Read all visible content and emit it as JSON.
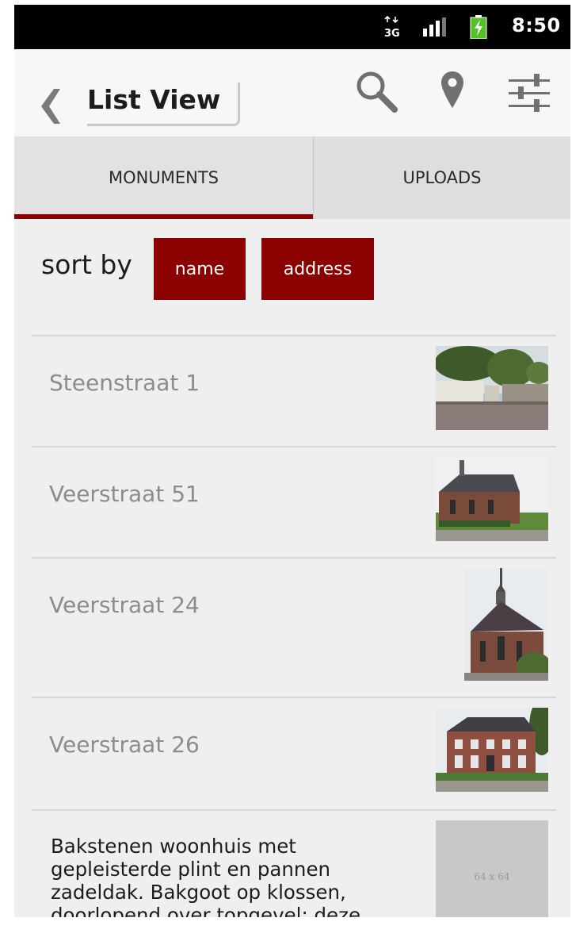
{
  "status_bar": {
    "time": "8:50",
    "network_label": "3G",
    "icons": [
      "data-3g-icon",
      "signal-icon",
      "battery-charging-icon"
    ]
  },
  "action_bar": {
    "title": "List View",
    "icons": [
      "back-chevron-icon",
      "search-icon",
      "map-pin-icon",
      "filter-sliders-icon"
    ]
  },
  "tabs": [
    {
      "label": "MONUMENTS",
      "selected": true
    },
    {
      "label": "UPLOADS",
      "selected": false
    }
  ],
  "sort": {
    "label": "sort by",
    "options": [
      "name",
      "address"
    ]
  },
  "list": {
    "items": [
      {
        "title": "Steenstraat 1",
        "thumbnail": "photo-street-wall"
      },
      {
        "title": "Veerstraat 51",
        "thumbnail": "photo-brick-chapel"
      },
      {
        "title": "Veerstraat 24",
        "thumbnail": "photo-church-steeple"
      },
      {
        "title": "Veerstraat 26",
        "thumbnail": "photo-mansion"
      },
      {
        "title": "Bakstenen woonhuis met gepleisterde plint en pannen zadeldak. Bakgoot op klossen, doorlopend over topgevel; deze",
        "thumbnail_placeholder": "64 x 64"
      }
    ]
  },
  "colors": {
    "accent": "#8b0000",
    "background": "#efefef",
    "status_bar": "#000000",
    "tab_bar": "#dcdcdc",
    "muted_text": "#8c8c8c"
  }
}
